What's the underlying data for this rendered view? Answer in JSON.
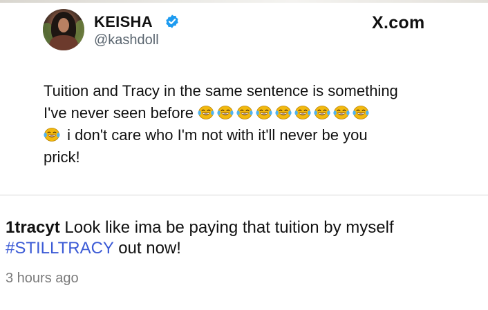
{
  "site": {
    "label": "X.com"
  },
  "tweet": {
    "author_name": "KEISHA",
    "author_handle": "@kashdoll",
    "verified_icon": "verified-badge-icon",
    "line1": "Tuition and Tracy in the same sentence is something",
    "line2_text": "I've never seen before",
    "line3_text": "i don't care who I'm not with it'll never be you",
    "line4_text": "prick!",
    "emoji_name": "face-with-tears-of-joy",
    "emoji_color": "#f2b90f"
  },
  "comment": {
    "username": "1tracyt",
    "text_part1": "Look like ima be paying that tuition by myself",
    "hashtag": "#STILLTRACY",
    "text_part2": "out now!",
    "timestamp": "3 hours ago",
    "hashtag_color": "#3c5bd6"
  }
}
